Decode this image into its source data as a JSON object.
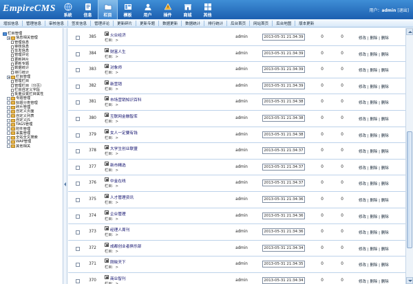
{
  "app": {
    "logo_text": "EmpireCMS"
  },
  "header": {
    "nav": [
      {
        "label": "系统",
        "icon": "globe-icon"
      },
      {
        "label": "信息",
        "icon": "info-icon"
      },
      {
        "label": "栏目",
        "icon": "folder-icon"
      },
      {
        "label": "模板",
        "icon": "template-icon"
      },
      {
        "label": "用户",
        "icon": "user-icon"
      },
      {
        "label": "插件",
        "icon": "plugin-icon"
      },
      {
        "label": "商城",
        "icon": "shop-icon"
      },
      {
        "label": "其他",
        "icon": "other-icon"
      }
    ],
    "active_nav": "栏目",
    "user_prefix": "用户：",
    "username": "admin",
    "logout": "[退出]"
  },
  "subnav": [
    "增加信息",
    "管理信息",
    "审核信息",
    "签发信息",
    "管理评论",
    "更新碎片",
    "更新专题",
    "数据更新",
    "数据统计",
    "排行统计",
    "后台首页",
    "网站首页",
    "后台地图",
    "版本更新"
  ],
  "sidebar": {
    "tree": [
      {
        "label": "栏目管理",
        "level": 0,
        "kind": "root"
      },
      {
        "label": "信息相关管理",
        "level": 1,
        "kind": "folder-open"
      },
      {
        "label": "管理信息",
        "level": 2,
        "kind": "doc"
      },
      {
        "label": "审核信息",
        "level": 2,
        "kind": "doc"
      },
      {
        "label": "签发信息",
        "level": 2,
        "kind": "doc"
      },
      {
        "label": "管理评论",
        "level": 2,
        "kind": "doc"
      },
      {
        "label": "更新碎片",
        "level": 2,
        "kind": "doc"
      },
      {
        "label": "更新专题",
        "level": 2,
        "kind": "doc"
      },
      {
        "label": "数据统计",
        "level": 2,
        "kind": "doc"
      },
      {
        "label": "排行统计",
        "level": 2,
        "kind": "doc"
      },
      {
        "label": "栏目管理",
        "level": 1,
        "kind": "folder-open"
      },
      {
        "label": "管理栏目",
        "level": 2,
        "kind": "doc"
      },
      {
        "label": "管理栏目（分页）",
        "level": 2,
        "kind": "doc"
      },
      {
        "label": "栏目自定义字段",
        "level": 2,
        "kind": "doc"
      },
      {
        "label": "批量设置栏目属性",
        "level": 2,
        "kind": "doc"
      },
      {
        "label": "专题管理",
        "level": 1,
        "kind": "folder"
      },
      {
        "label": "标题分类管理",
        "level": 1,
        "kind": "folder"
      },
      {
        "label": "碎片管理",
        "level": 1,
        "kind": "folder"
      },
      {
        "label": "自定义页面",
        "level": 1,
        "kind": "folder"
      },
      {
        "label": "自定义列表",
        "level": 1,
        "kind": "folder"
      },
      {
        "label": "自定义JS",
        "level": 1,
        "kind": "folder"
      },
      {
        "label": "TAGS管理",
        "level": 1,
        "kind": "folder"
      },
      {
        "label": "附件管理",
        "level": 1,
        "kind": "folder"
      },
      {
        "label": "采集管理",
        "level": 1,
        "kind": "folder"
      },
      {
        "label": "全站全文搜索",
        "level": 1,
        "kind": "folder"
      },
      {
        "label": "WAP管理",
        "level": 1,
        "kind": "folder"
      },
      {
        "label": "其他相关",
        "level": 1,
        "kind": "folder"
      }
    ]
  },
  "table": {
    "rows": [
      {
        "id": "385",
        "title": "火业经济",
        "column": "栏目：>",
        "author": "admin",
        "date": "2013-05-31 21:34:39",
        "views": "0",
        "comments": "0",
        "edit": "修改",
        "delete": "删除",
        "deltwo": "删除"
      },
      {
        "id": "384",
        "title": "财富人生",
        "column": "栏目：>",
        "author": "admin",
        "date": "2013-05-31 21:34:39",
        "views": "0",
        "comments": "0",
        "edit": "修改",
        "delete": "删除",
        "deltwo": "删除"
      },
      {
        "id": "383",
        "title": "对象师",
        "column": "栏目：>",
        "author": "admin",
        "date": "2013-05-31 21:34:39",
        "views": "0",
        "comments": "0",
        "edit": "修改",
        "delete": "删除",
        "deltwo": "删除"
      },
      {
        "id": "382",
        "title": "新营销",
        "column": "栏目：>",
        "author": "admin",
        "date": "2013-05-31 21:34:39",
        "views": "0",
        "comments": "0",
        "edit": "修改",
        "delete": "删除",
        "deltwo": "删除"
      },
      {
        "id": "381",
        "title": "市场营销知识百科",
        "column": "栏目：>",
        "author": "admin",
        "date": "2013-05-31 21:34:38",
        "views": "0",
        "comments": "0",
        "edit": "修改",
        "delete": "删除",
        "deltwo": "删除"
      },
      {
        "id": "380",
        "title": "互联网金融智库",
        "column": "栏目：>",
        "author": "admin",
        "date": "2013-05-31 21:34:38",
        "views": "0",
        "comments": "0",
        "edit": "修改",
        "delete": "删除",
        "deltwo": "删除"
      },
      {
        "id": "379",
        "title": "女人一定要有钱",
        "column": "栏目：>",
        "author": "admin",
        "date": "2013-05-31 21:34:38",
        "views": "0",
        "comments": "0",
        "edit": "修改",
        "delete": "删除",
        "deltwo": "删除"
      },
      {
        "id": "378",
        "title": "大学生创业联盟",
        "column": "栏目：>",
        "author": "admin",
        "date": "2013-05-31 21:34:37",
        "views": "0",
        "comments": "0",
        "edit": "修改",
        "delete": "删除",
        "deltwo": "删除"
      },
      {
        "id": "377",
        "title": "新市精选",
        "column": "栏目：>",
        "author": "admin",
        "date": "2013-05-31 21:34:37",
        "views": "0",
        "comments": "0",
        "edit": "修改",
        "delete": "删除",
        "deltwo": "删除"
      },
      {
        "id": "376",
        "title": "中金在线",
        "column": "栏目：>",
        "author": "admin",
        "date": "2013-05-31 21:34:37",
        "views": "0",
        "comments": "0",
        "edit": "修改",
        "delete": "删除",
        "deltwo": "删除"
      },
      {
        "id": "375",
        "title": "人才管理资讯",
        "column": "栏目：>",
        "author": "admin",
        "date": "2013-05-31 21:34:36",
        "views": "0",
        "comments": "0",
        "edit": "修改",
        "delete": "删除",
        "deltwo": "删除"
      },
      {
        "id": "374",
        "title": "企业管理",
        "column": "栏目：>",
        "author": "admin",
        "date": "2013-05-31 21:34:36",
        "views": "0",
        "comments": "0",
        "edit": "修改",
        "delete": "删除",
        "deltwo": "删除"
      },
      {
        "id": "373",
        "title": "经理人周刊",
        "column": "栏目：>",
        "author": "admin",
        "date": "2013-05-31 21:34:36",
        "views": "0",
        "comments": "0",
        "edit": "修改",
        "delete": "删除",
        "deltwo": "删除"
      },
      {
        "id": "372",
        "title": "成都创业者俱乐部",
        "column": "栏目：>",
        "author": "admin",
        "date": "2013-05-31 21:34:34",
        "views": "0",
        "comments": "0",
        "edit": "修改",
        "delete": "删除",
        "deltwo": "删除"
      },
      {
        "id": "371",
        "title": "刚晓天下",
        "column": "栏目：>",
        "author": "admin",
        "date": "2013-05-31 21:34:35",
        "views": "0",
        "comments": "0",
        "edit": "修改",
        "delete": "删除",
        "deltwo": "删除"
      },
      {
        "id": "370",
        "title": "商业智刊",
        "column": "栏目：>",
        "author": "admin",
        "date": "2013-05-31 21:34:34",
        "views": "0",
        "comments": "0",
        "edit": "修改",
        "delete": "删除",
        "deltwo": "删除"
      }
    ]
  },
  "colors": {
    "header_top": "#3f8ed6",
    "header_bottom": "#1c5fb0",
    "row_border": "#bcd2ea",
    "title_text": "#0a0a6a"
  }
}
